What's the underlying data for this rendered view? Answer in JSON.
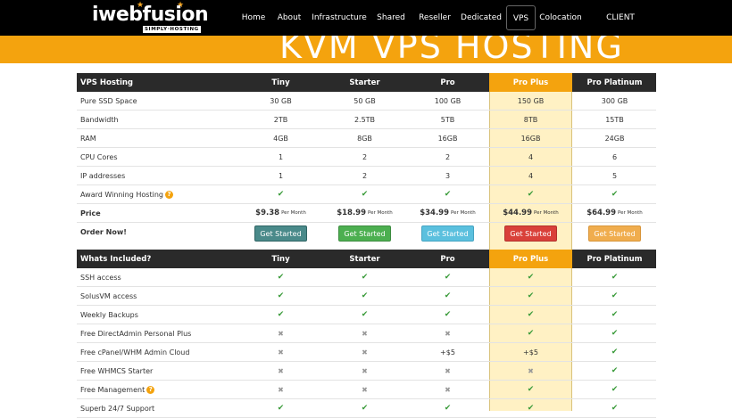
{
  "nav": {
    "logo_text": "iwebfusion",
    "logo_tagline": "SIMPLY·HOSTING",
    "items": [
      {
        "label": "Home"
      },
      {
        "label": "About"
      },
      {
        "label": "Infrastructure"
      },
      {
        "label": "Shared"
      },
      {
        "label": "Reseller"
      },
      {
        "label": "Dedicated"
      },
      {
        "label": "VPS"
      },
      {
        "label": "Colocation"
      },
      {
        "label": "CLIENT PORTAL"
      }
    ],
    "active": "VPS"
  },
  "hero": {
    "title": "KVM VPS HOSTING"
  },
  "plans_header": {
    "label": "VPS Hosting",
    "plans": [
      "Tiny",
      "Starter",
      "Pro",
      "Pro Plus",
      "Pro Platinum"
    ]
  },
  "specs": [
    {
      "label": "Pure SSD Space",
      "values": [
        "30 GB",
        "50 GB",
        "100 GB",
        "150 GB",
        "300 GB"
      ]
    },
    {
      "label": "Bandwidth",
      "values": [
        "2TB",
        "2.5TB",
        "5TB",
        "8TB",
        "15TB"
      ]
    },
    {
      "label": "RAM",
      "values": [
        "4GB",
        "8GB",
        "16GB",
        "16GB",
        "24GB"
      ]
    },
    {
      "label": "CPU Cores",
      "values": [
        "1",
        "2",
        "2",
        "4",
        "6"
      ]
    },
    {
      "label": "IP addresses",
      "values": [
        "1",
        "2",
        "3",
        "4",
        "5"
      ]
    }
  ],
  "award": {
    "label": "Award Winning Hosting",
    "help": "?"
  },
  "price": {
    "label": "Price",
    "per": "Per Month",
    "values": [
      "$9.38",
      "$18.99",
      "$34.99",
      "$44.99",
      "$64.99"
    ]
  },
  "order": {
    "label": "Order Now!",
    "button": "Get Started"
  },
  "included_header": {
    "label": "Whats Included?",
    "plans": [
      "Tiny",
      "Starter",
      "Pro",
      "Pro Plus",
      "Pro Platinum"
    ]
  },
  "features": [
    {
      "label": "SSH access",
      "values": [
        "check",
        "check",
        "check",
        "check",
        "check"
      ]
    },
    {
      "label": "SolusVM access",
      "values": [
        "check",
        "check",
        "check",
        "check",
        "check"
      ]
    },
    {
      "label": "Weekly Backups",
      "values": [
        "check",
        "check",
        "check",
        "check",
        "check"
      ]
    },
    {
      "label": "Free DirectAdmin Personal Plus",
      "values": [
        "cross",
        "cross",
        "cross",
        "check",
        "check"
      ]
    },
    {
      "label": "Free cPanel/WHM Admin Cloud",
      "values": [
        "cross",
        "cross",
        "+$5",
        "+$5",
        "check"
      ]
    },
    {
      "label": "Free WHMCS Starter",
      "values": [
        "cross",
        "cross",
        "cross",
        "cross",
        "check"
      ]
    },
    {
      "label": "Free Management",
      "help": "?",
      "values": [
        "cross",
        "cross",
        "cross",
        "check",
        "check"
      ]
    },
    {
      "label": "Superb 24/7 Support",
      "values": [
        "check",
        "check",
        "check",
        "check",
        "check"
      ]
    }
  ],
  "colors": {
    "accent": "#f4a30e",
    "highlight": "#fff1c4",
    "btn_tiny": "#4a8a8a",
    "btn_starter": "#4caf50",
    "btn_pro": "#5bc0de",
    "btn_proplus": "#d9403a",
    "btn_platinum": "#f0ad4e"
  }
}
